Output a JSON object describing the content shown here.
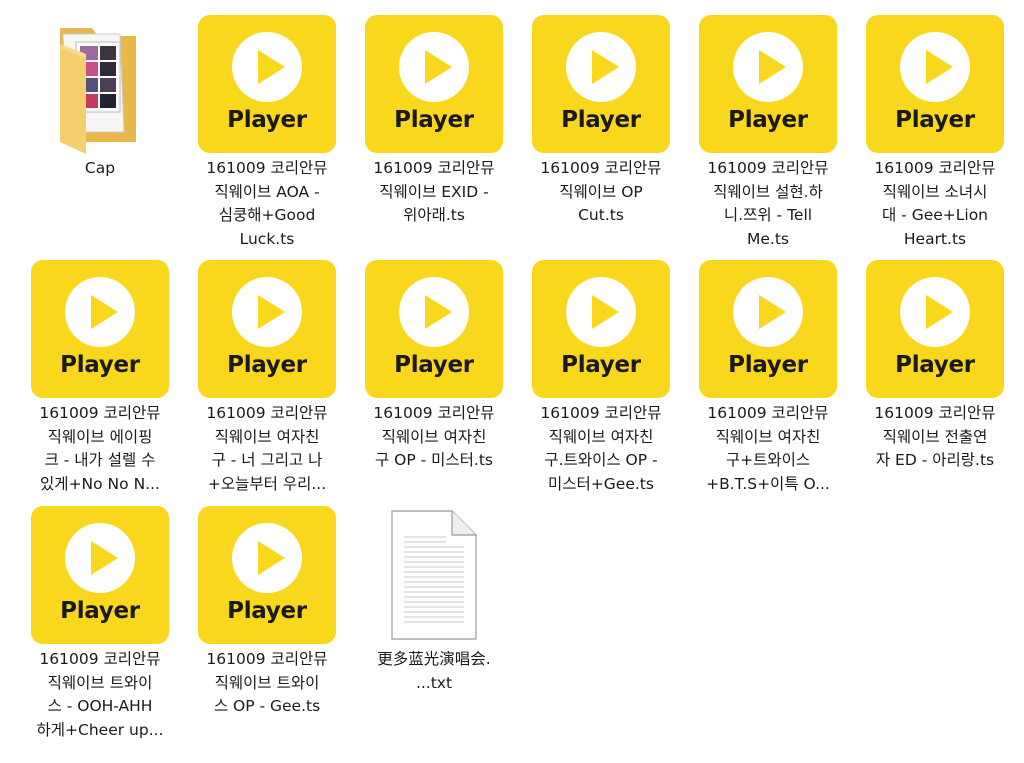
{
  "tile_word": "Player",
  "colors": {
    "tile": "#f9d71c",
    "play_circle": "#ffffff",
    "play_triangle": "#f9d71c",
    "text": "#1a1a1a",
    "folder": "#f2cd6b"
  },
  "items": [
    {
      "type": "folder",
      "icon": "folder-icon",
      "lines": [
        "Cap"
      ]
    },
    {
      "type": "player",
      "icon": "player-icon",
      "lines": [
        "161009 코리안뮤",
        "직웨이브 AOA -",
        "심쿵해+Good",
        "Luck.ts"
      ]
    },
    {
      "type": "player",
      "icon": "player-icon",
      "lines": [
        "161009 코리안뮤",
        "직웨이브 EXID -",
        "위아래.ts"
      ]
    },
    {
      "type": "player",
      "icon": "player-icon",
      "lines": [
        "161009 코리안뮤",
        "직웨이브 OP",
        "Cut.ts"
      ]
    },
    {
      "type": "player",
      "icon": "player-icon",
      "lines": [
        "161009 코리안뮤",
        "직웨이브 설현.하",
        "니.쯔위 - Tell",
        "Me.ts"
      ]
    },
    {
      "type": "player",
      "icon": "player-icon",
      "lines": [
        "161009 코리안뮤",
        "직웨이브 소녀시",
        "대 - Gee+Lion",
        "Heart.ts"
      ]
    },
    {
      "type": "player",
      "icon": "player-icon",
      "lines": [
        "161009 코리안뮤",
        "직웨이브 에이핑",
        "크 - 내가 설렐 수",
        "있게+No No N..."
      ]
    },
    {
      "type": "player",
      "icon": "player-icon",
      "lines": [
        "161009 코리안뮤",
        "직웨이브 여자친",
        "구 - 너 그리고 나",
        "+오늘부터 우리..."
      ]
    },
    {
      "type": "player",
      "icon": "player-icon",
      "lines": [
        "161009 코리안뮤",
        "직웨이브 여자친",
        "구 OP - 미스터.ts"
      ]
    },
    {
      "type": "player",
      "icon": "player-icon",
      "lines": [
        "161009 코리안뮤",
        "직웨이브 여자친",
        "구.트와이스 OP -",
        "미스터+Gee.ts"
      ]
    },
    {
      "type": "player",
      "icon": "player-icon",
      "lines": [
        "161009 코리안뮤",
        "직웨이브 여자친",
        "구+트와이스",
        "+B.T.S+이특 O..."
      ]
    },
    {
      "type": "player",
      "icon": "player-icon",
      "lines": [
        "161009 코리안뮤",
        "직웨이브 전출연",
        "자 ED - 아리랑.ts"
      ]
    },
    {
      "type": "player",
      "icon": "player-icon",
      "lines": [
        "161009 코리안뮤",
        "직웨이브 트와이",
        "스 - OOH-AHH",
        "하게+Cheer up..."
      ]
    },
    {
      "type": "player",
      "icon": "player-icon",
      "lines": [
        "161009 코리안뮤",
        "직웨이브 트와이",
        "스 OP - Gee.ts"
      ]
    },
    {
      "type": "text",
      "icon": "text-document-icon",
      "lines": [
        "更多蓝光演唱会.",
        "...txt"
      ]
    }
  ]
}
